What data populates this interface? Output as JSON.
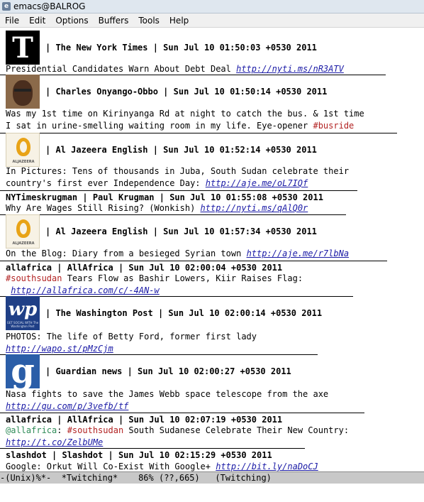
{
  "window": {
    "title": "emacs@BALROG"
  },
  "menubar": {
    "items": [
      "File",
      "Edit",
      "Options",
      "Buffers",
      "Tools",
      "Help"
    ]
  },
  "tweets": [
    {
      "avatar": "nyt-logo",
      "header": "| The New York Times | Sun Jul 10 01:50:03 +0530 2011",
      "lines": [
        [
          {
            "t": "Presidential Candidates Warn About Debt Deal "
          },
          {
            "t": "http://nyti.ms/nR3ATV",
            "k": "link"
          }
        ]
      ]
    },
    {
      "avatar": "person-photo",
      "header": "| Charles Onyango-Obbo | Sun Jul 10 01:50:14 +0530 2011",
      "lines": [
        [
          {
            "t": "Was my 1st time on Kirinyanga Rd at night to catch the bus. & 1st time"
          }
        ],
        [
          {
            "t": "I sat in urine-smelling waiting room in my life. Eye-opener "
          },
          {
            "t": "#busride",
            "k": "hash"
          }
        ]
      ]
    },
    {
      "avatar": "aljazeera-logo",
      "header": "| Al Jazeera English | Sun Jul 10 01:52:14 +0530 2011",
      "lines": [
        [
          {
            "t": "In Pictures: Tens of thousands in Juba, South Sudan celebrate their"
          }
        ],
        [
          {
            "t": "country's first ever Independence Day: "
          },
          {
            "t": "http://aje.me/oL7IQf",
            "k": "link"
          }
        ]
      ]
    },
    {
      "avatar": null,
      "header": "NYTimeskrugman | Paul Krugman | Sun Jul 10 01:55:08 +0530 2011",
      "lines": [
        [
          {
            "t": "Why Are Wages Still Rising? (Wonkish) "
          },
          {
            "t": "http://nyti.ms/qAlQ0r",
            "k": "link"
          }
        ]
      ]
    },
    {
      "avatar": "aljazeera-logo",
      "header": "| Al Jazeera English | Sun Jul 10 01:57:34 +0530 2011",
      "lines": [
        [
          {
            "t": "On the Blog: Diary from a besieged Syrian town "
          },
          {
            "t": "http://aje.me/r7lbNa",
            "k": "link"
          }
        ]
      ]
    },
    {
      "avatar": null,
      "header": "allafrica | AllAfrica | Sun Jul 10 02:00:04 +0530 2011",
      "lines": [
        [
          {
            "t": "#southsudan",
            "k": "hash"
          },
          {
            "t": " Tears Flow as Bashir Lowers, Kiir Raises Flag:"
          }
        ],
        [
          {
            "t": " "
          },
          {
            "t": "http://allafrica.com/c/-4AN-w",
            "k": "link"
          }
        ]
      ]
    },
    {
      "avatar": "washingtonpost-logo",
      "header": "| The Washington Post | Sun Jul 10 02:00:14 +0530 2011",
      "lines": [
        [
          {
            "t": "PHOTOS: The life of Betty Ford, former first lady"
          }
        ],
        [
          {
            "t": "http://wapo.st/pMzCjm",
            "k": "link"
          }
        ]
      ]
    },
    {
      "avatar": "guardian-logo",
      "header": "| Guardian news | Sun Jul 10 02:00:27 +0530 2011",
      "lines": [
        [
          {
            "t": "Nasa fights to save the James Webb space telescope from the axe"
          }
        ],
        [
          {
            "t": "http://gu.com/p/3vefb/tf",
            "k": "link"
          }
        ]
      ]
    },
    {
      "avatar": null,
      "header": "allafrica | AllAfrica | Sun Jul 10 02:07:19 +0530 2011",
      "lines": [
        [
          {
            "t": "@allafrica",
            "k": "mention"
          },
          {
            "t": ": "
          },
          {
            "t": "#southsudan",
            "k": "hash"
          },
          {
            "t": " South Sudanese Celebrate Their New Country:"
          }
        ],
        [
          {
            "t": "http://t.co/ZelbUMe",
            "k": "link"
          }
        ]
      ]
    },
    {
      "avatar": null,
      "header": "slashdot | Slashdot | Sun Jul 10 02:15:29 +0530 2011",
      "lines": [
        [
          {
            "t": "Google: Orkut Will Co-Exist With Google+ "
          },
          {
            "t": "http://bit.ly/naDoCJ",
            "k": "link"
          }
        ]
      ]
    }
  ],
  "avatar_text": {
    "nyt": "T",
    "aljazeera": "ALJAZEERA",
    "washingtonpost": "wp",
    "washingtonpost_sub": "GET SOCIAL WITH The Washington Post",
    "guardian": "g"
  },
  "modeline": {
    "text": "-(Unix)%*-  *Twitching*    86% (??,665)   (Twitching)"
  }
}
